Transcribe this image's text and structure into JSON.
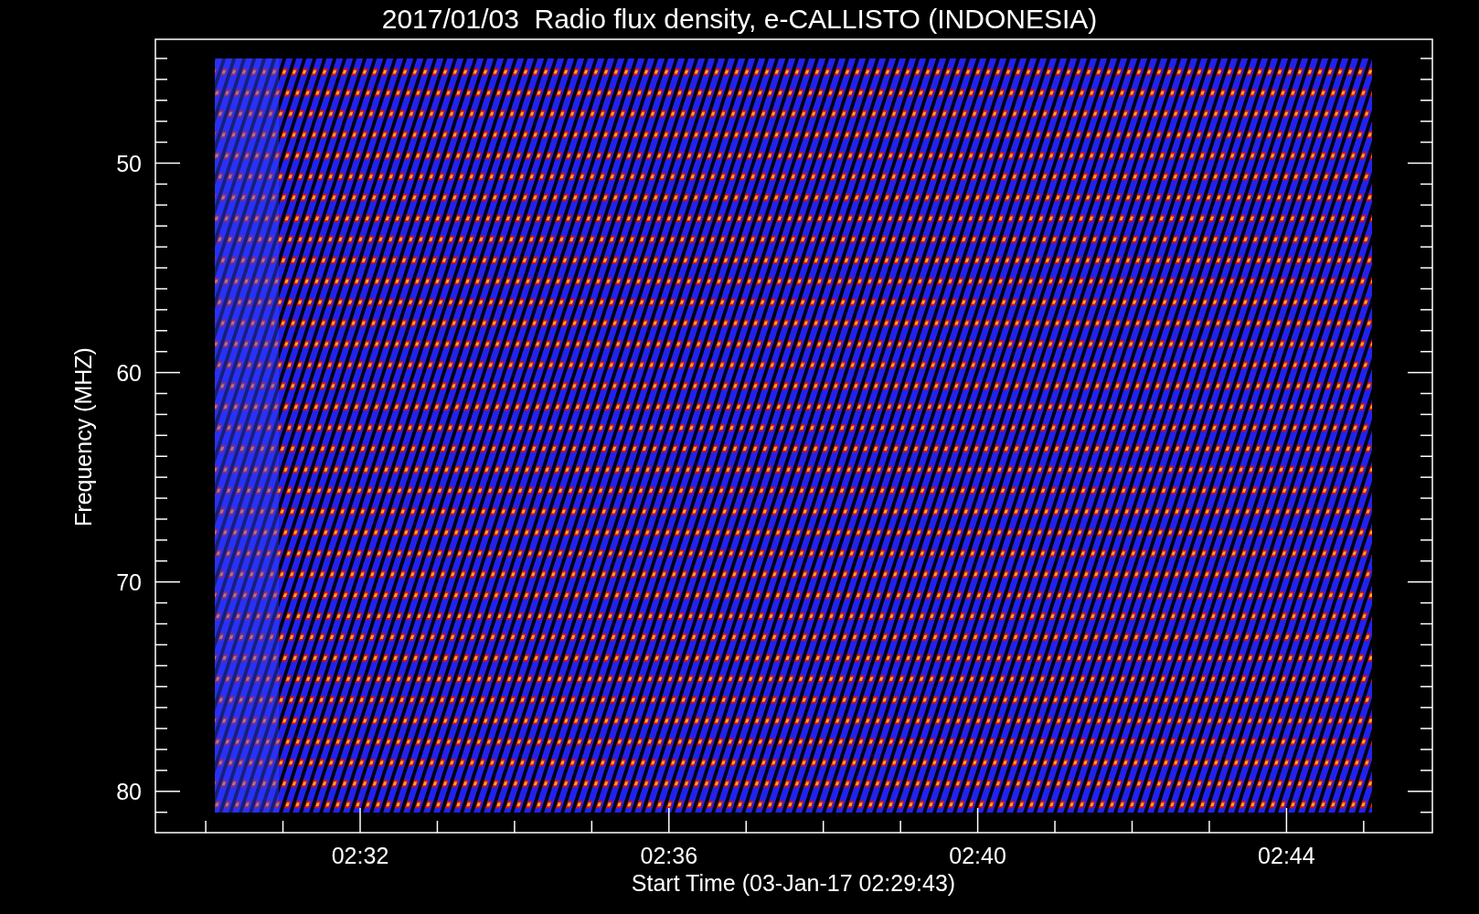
{
  "title": "2017/01/03  Radio flux density, e-CALLISTO (INDONESIA)",
  "y_axis": {
    "label": "Frequency (MHZ)",
    "ticks": [
      "50",
      "60",
      "70",
      "80"
    ]
  },
  "x_axis": {
    "label": "Start Time (03-Jan-17 02:29:43)",
    "ticks": [
      "02:32",
      "02:36",
      "02:40",
      "02:44"
    ]
  }
}
